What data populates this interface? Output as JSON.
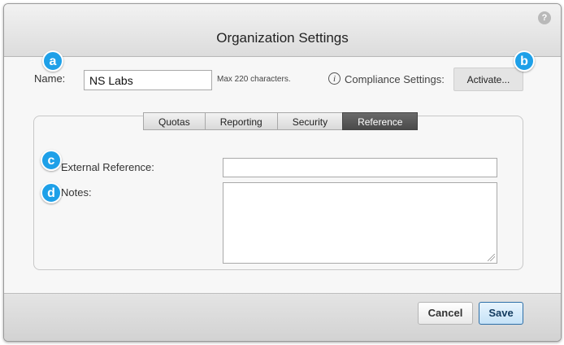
{
  "dialog": {
    "title": "Organization Settings",
    "help_icon": "question-icon"
  },
  "badges": {
    "a": "a",
    "b": "b",
    "c": "c",
    "d": "d"
  },
  "name_field": {
    "label": "Name:",
    "value": "NS Labs",
    "hint": "Max 220 characters."
  },
  "compliance": {
    "info_icon": "info-icon",
    "label": "Compliance Settings:",
    "button_label": "Activate..."
  },
  "tabs": [
    {
      "label": "Quotas",
      "active": false
    },
    {
      "label": "Reporting",
      "active": false
    },
    {
      "label": "Security",
      "active": false
    },
    {
      "label": "Reference",
      "active": true
    }
  ],
  "reference": {
    "external_reference_label": "External Reference:",
    "external_reference_value": "",
    "notes_label": "Notes:",
    "notes_value": ""
  },
  "footer": {
    "cancel_label": "Cancel",
    "save_label": "Save"
  },
  "colors": {
    "badge": "#1ea0e8",
    "active_tab": "#4a4a4a",
    "save_border": "#2e6fa8"
  }
}
